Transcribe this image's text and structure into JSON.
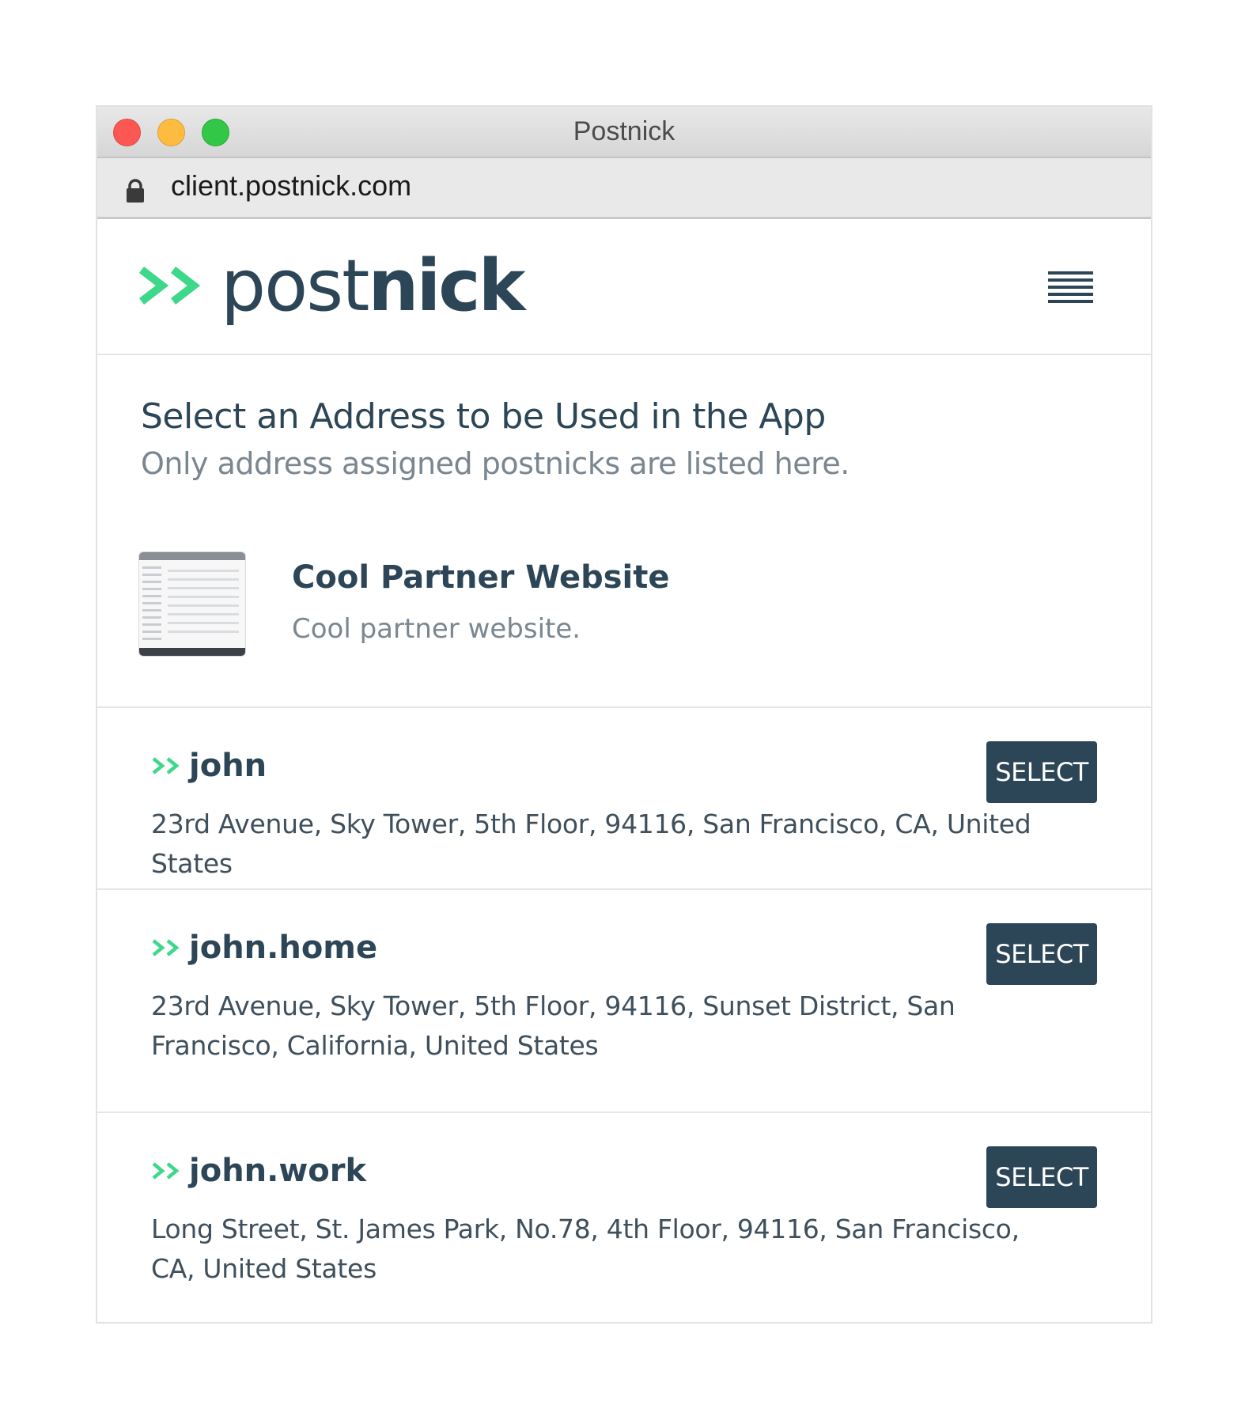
{
  "window": {
    "title": "Postnick",
    "url": "client.postnick.com"
  },
  "logo": {
    "light": "post",
    "bold": "nick"
  },
  "intro": {
    "title": "Select an Address to be Used in the App",
    "subtitle": "Only address assigned postnicks are listed here."
  },
  "partner": {
    "name": "Cool Partner Website",
    "description": "Cool partner website."
  },
  "addresses": [
    {
      "name": "john",
      "address": "23rd Avenue, Sky Tower, 5th Floor, 94116, San Francisco, CA, United States",
      "button": "SELECT"
    },
    {
      "name": "john.home",
      "address": "23rd Avenue, Sky Tower, 5th Floor, 94116, Sunset District, San Francisco, California, United States",
      "button": "SELECT"
    },
    {
      "name": "john.work",
      "address": "Long Street, St. James Park, No.78, 4th Floor, 94116, San Francisco, CA, United States",
      "button": "SELECT"
    }
  ],
  "colors": {
    "brand_dark": "#2c4657",
    "brand_green": "#3dd88a",
    "muted_text": "#7a8690"
  },
  "icons": {
    "lock": "lock-icon",
    "menu": "hamburger-menu-icon",
    "arrows": "double-chevron-right-icon"
  }
}
